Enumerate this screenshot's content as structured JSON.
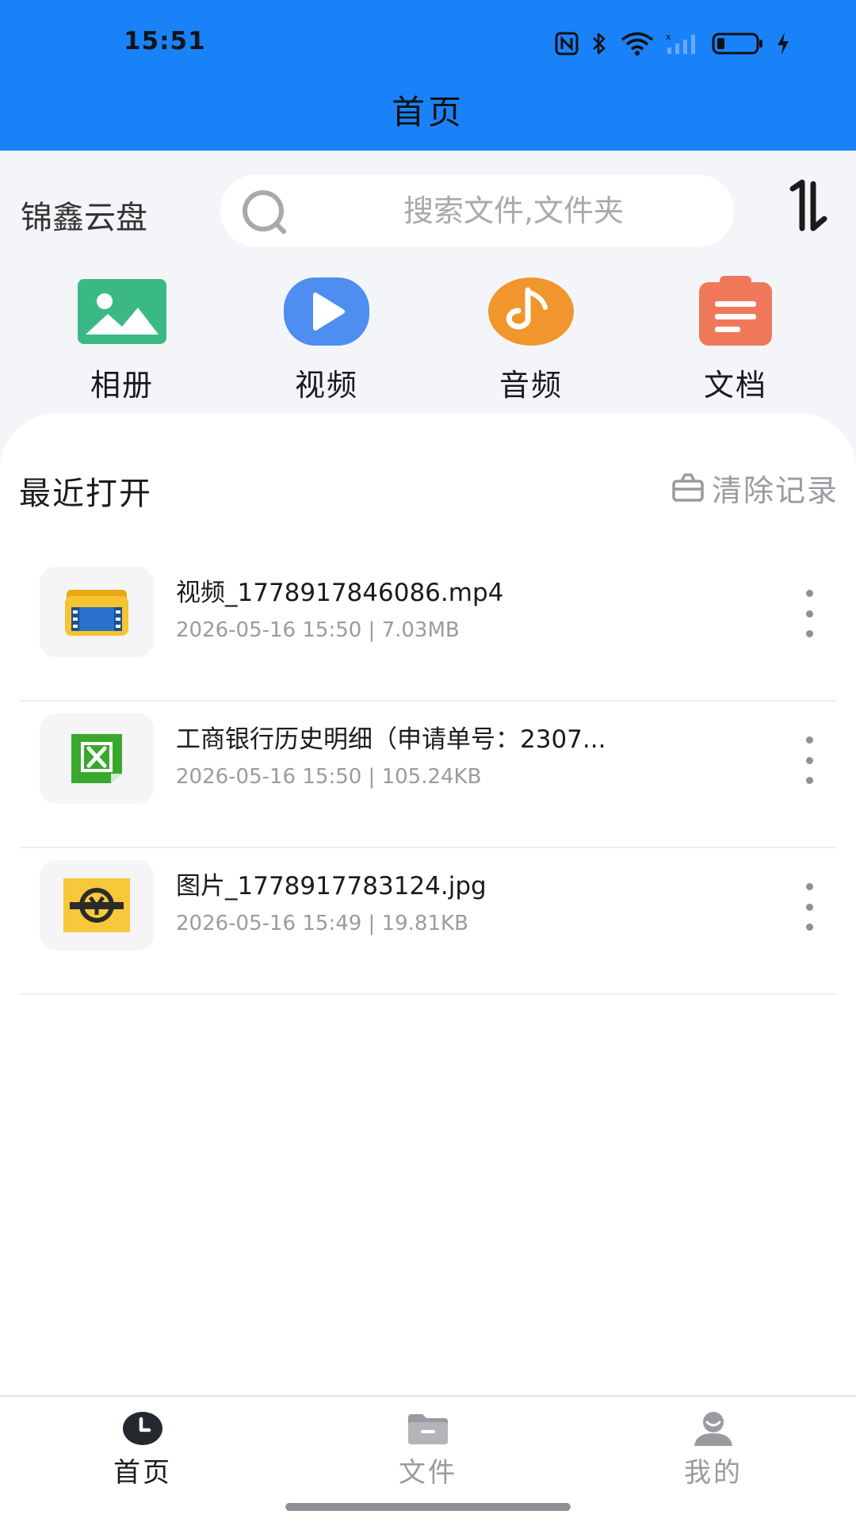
{
  "status_bar": {
    "time": "15:51"
  },
  "header": {
    "title": "首页"
  },
  "brand": {
    "name": "锦鑫云盘"
  },
  "search": {
    "placeholder": "搜索文件,文件夹",
    "value": ""
  },
  "categories": [
    {
      "label": "相册",
      "icon": "album-icon",
      "color": "#3bb985"
    },
    {
      "label": "视频",
      "icon": "video-icon",
      "color": "#4d8ef0"
    },
    {
      "label": "音频",
      "icon": "audio-icon",
      "color": "#f0962c"
    },
    {
      "label": "文档",
      "icon": "document-icon",
      "color": "#f0785a"
    }
  ],
  "recent": {
    "title": "最近打开",
    "clear_label": "清除记录",
    "files": [
      {
        "name": "视频_1778917846086.mp4",
        "meta": "2026-05-16 15:50 | 7.03MB",
        "icon": "video-file-icon"
      },
      {
        "name": "工商银行历史明细（申请单号：2307...",
        "meta": "2026-05-16 15:50 | 105.24KB",
        "icon": "excel-file-icon"
      },
      {
        "name": "图片_1778917783124.jpg",
        "meta": "2026-05-16 15:49 | 19.81KB",
        "icon": "image-file-icon"
      }
    ]
  },
  "bottom_nav": {
    "items": [
      {
        "label": "首页",
        "icon": "clock-icon",
        "active": true
      },
      {
        "label": "文件",
        "icon": "folder-icon",
        "active": false
      },
      {
        "label": "我的",
        "icon": "user-icon",
        "active": false
      }
    ]
  },
  "colors": {
    "header_bg": "#1a82f9",
    "page_bg": "#f4f5f8",
    "muted_text": "#9a9ba0"
  }
}
